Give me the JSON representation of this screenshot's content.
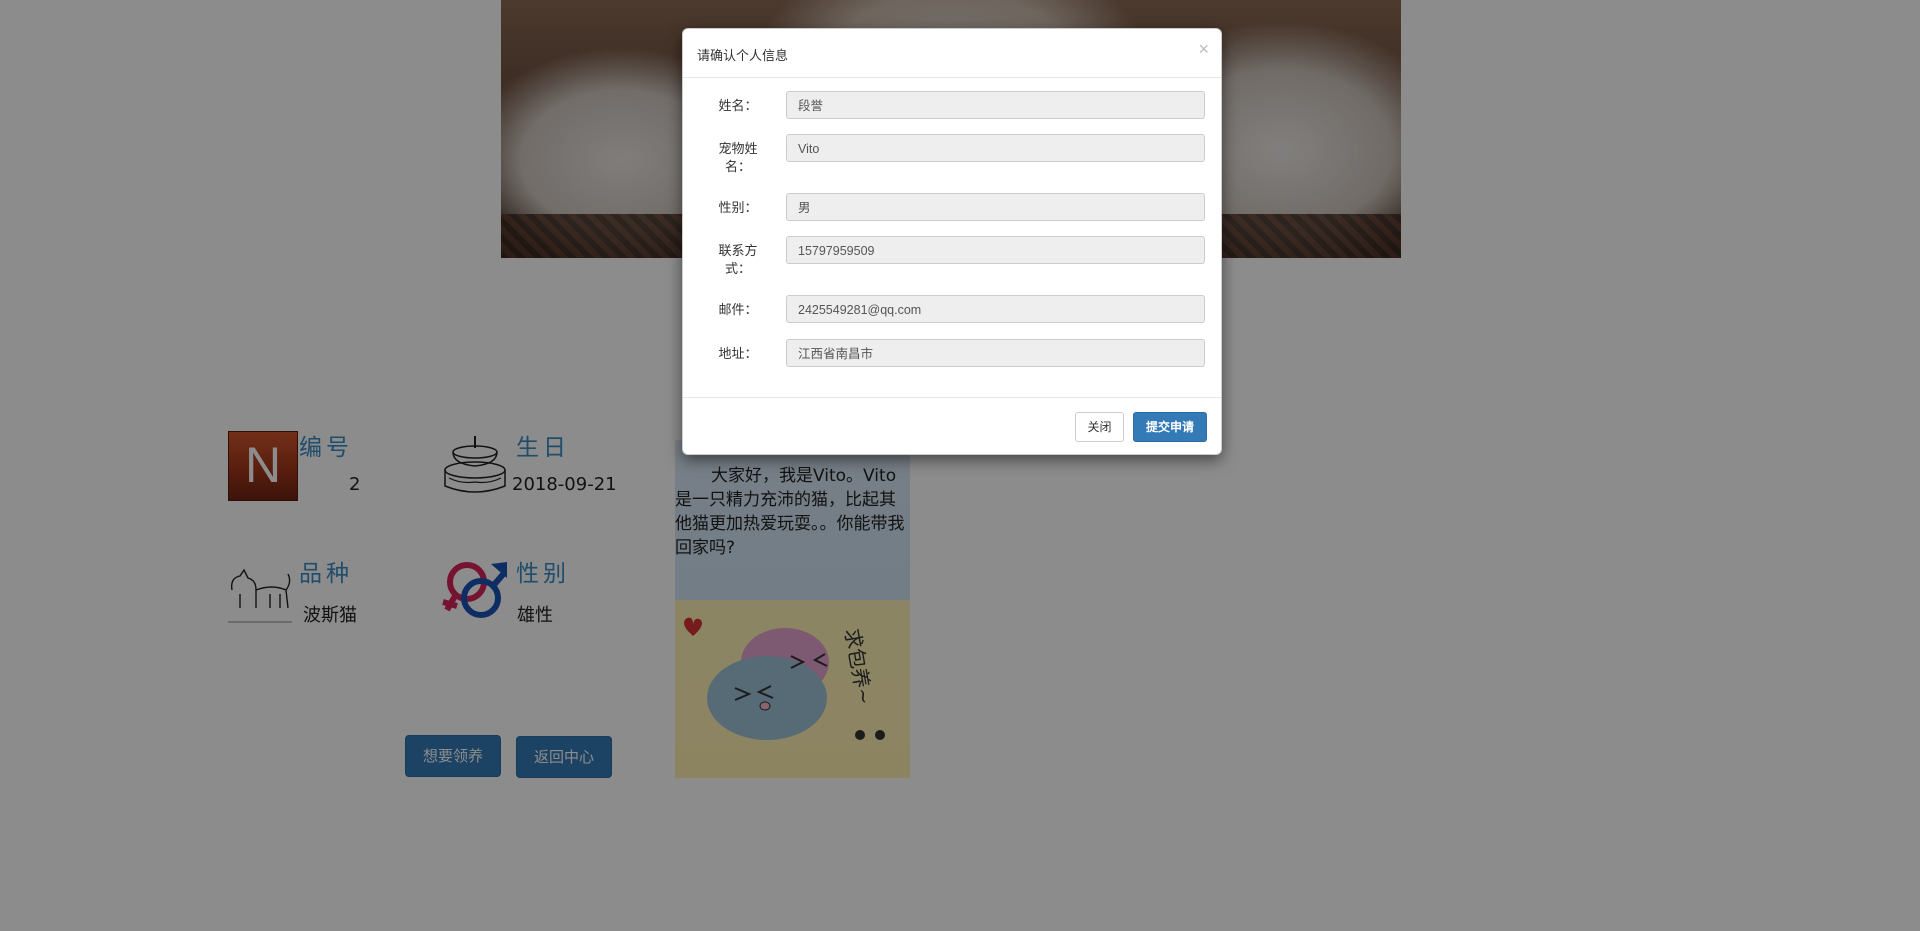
{
  "modal": {
    "title": "请确认个人信息",
    "close_symbol": "×",
    "fields": [
      {
        "label": "姓名：",
        "value": "段誉"
      },
      {
        "label": "宠物姓名：",
        "value": "Vito"
      },
      {
        "label": "性别：",
        "value": "男"
      },
      {
        "label": "联系方式：",
        "value": "15797959509"
      },
      {
        "label": "邮件：",
        "value": "2425549281@qq.com"
      },
      {
        "label": "地址：",
        "value": "江西省南昌市"
      }
    ],
    "close_label": "关闭",
    "submit_label": "提交申请"
  },
  "pet_info": {
    "number_label": "编号",
    "number_value": "2",
    "number_icon_letter": "N",
    "birthday_label": "生日",
    "birthday_value": "2018-09-21",
    "breed_label": "品种",
    "breed_value": "波斯猫",
    "gender_label": "性别",
    "gender_value": "雄性"
  },
  "story": {
    "text": "大家好，我是Vito。Vito是一只精力充沛的猫，比起其他猫更加热爱玩耍。。你能带我回家吗?",
    "art_text": "求包养~"
  },
  "actions": {
    "adopt_label": "想要领养",
    "back_label": "返回中心"
  },
  "colors": {
    "primary": "#337ab7",
    "label_blue": "#3a8dc4",
    "backdrop": "rgba(0,0,0,0.45)"
  }
}
